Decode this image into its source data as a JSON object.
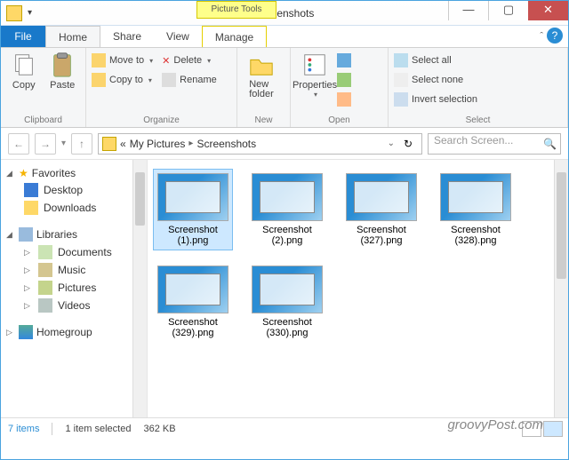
{
  "window": {
    "title": "Screenshots",
    "context_tools": "Picture Tools",
    "min": "—",
    "max": "▢",
    "close": "✕"
  },
  "tabs": {
    "file": "File",
    "items": [
      "Home",
      "Share",
      "View"
    ],
    "ctx": "Manage",
    "active": 0
  },
  "ribbon": {
    "clipboard": {
      "label": "Clipboard",
      "copy": "Copy",
      "paste": "Paste"
    },
    "organize": {
      "label": "Organize",
      "moveto": "Move to",
      "copyto": "Copy to",
      "delete": "Delete",
      "rename": "Rename"
    },
    "new": {
      "label": "New",
      "newfolder": "New\nfolder"
    },
    "open": {
      "label": "Open",
      "properties": "Properties"
    },
    "select": {
      "label": "Select",
      "all": "Select all",
      "none": "Select none",
      "invert": "Invert selection"
    }
  },
  "address": {
    "crumbs": [
      "«",
      "My Pictures",
      "Screenshots"
    ],
    "search_placeholder": "Search Screen..."
  },
  "nav": {
    "favorites": {
      "label": "Favorites",
      "items": [
        "Desktop",
        "Downloads"
      ]
    },
    "libraries": {
      "label": "Libraries",
      "items": [
        "Documents",
        "Music",
        "Pictures",
        "Videos"
      ]
    },
    "homegroup": {
      "label": "Homegroup"
    }
  },
  "files": [
    {
      "name": "Screenshot (1).png",
      "selected": true
    },
    {
      "name": "Screenshot (2).png",
      "selected": false
    },
    {
      "name": "Screenshot (327).png",
      "selected": false
    },
    {
      "name": "Screenshot (328).png",
      "selected": false
    },
    {
      "name": "Screenshot (329).png",
      "selected": false
    },
    {
      "name": "Screenshot (330).png",
      "selected": false
    }
  ],
  "status": {
    "count": "7 items",
    "selected": "1 item selected",
    "size": "362 KB"
  },
  "watermark": "groovyPost.com"
}
